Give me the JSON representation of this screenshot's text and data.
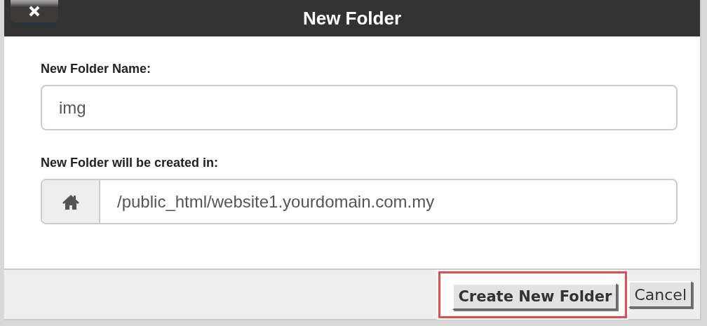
{
  "dialog": {
    "title": "New Folder",
    "fields": [
      {
        "kind": "text",
        "label": "New Folder Name:",
        "value": "img"
      },
      {
        "kind": "path",
        "label": "New Folder will be created in:",
        "value": "/public_html/website1.yourdomain.com.my"
      }
    ],
    "buttons": [
      {
        "label": "Create New Folder",
        "highlighted": true
      },
      {
        "label": "Cancel",
        "highlighted": false
      }
    ]
  }
}
